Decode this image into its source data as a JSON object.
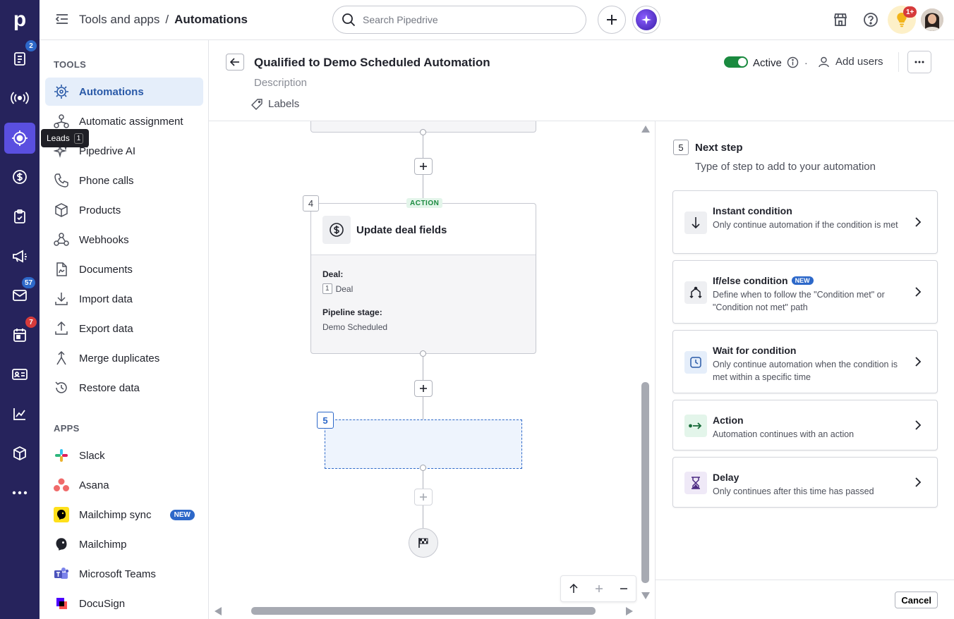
{
  "app": {
    "logo": "p"
  },
  "rail": {
    "items": [
      {
        "icon": "contacts-icon",
        "badge": "2"
      },
      {
        "icon": "broadcast-icon",
        "badge": ""
      },
      {
        "icon": "target-icon",
        "badge": "",
        "active": true
      },
      {
        "icon": "dollar-icon",
        "badge": ""
      },
      {
        "icon": "clipboard-icon",
        "badge": ""
      },
      {
        "icon": "megaphone-icon",
        "badge": ""
      },
      {
        "icon": "mail-icon",
        "badge": "57"
      },
      {
        "icon": "calendar-icon",
        "badge": "7"
      },
      {
        "icon": "id-card-icon",
        "badge": ""
      },
      {
        "icon": "chart-icon",
        "badge": ""
      },
      {
        "icon": "box-icon",
        "badge": ""
      },
      {
        "icon": "more-icon",
        "badge": ""
      }
    ],
    "tooltip": {
      "label": "Leads",
      "key": "1"
    }
  },
  "topbar": {
    "breadcrumb_parent": "Tools and apps",
    "breadcrumb_sep": "/",
    "breadcrumb_current": "Automations",
    "search_placeholder": "Search Pipedrive",
    "notif_badge": "1+"
  },
  "sidebar": {
    "tools_title": "TOOLS",
    "tools": [
      {
        "label": "Automations",
        "icon": "automation-icon",
        "active": true
      },
      {
        "label": "Automatic assignment",
        "icon": "assignment-icon"
      },
      {
        "label": "Pipedrive AI",
        "icon": "sparkle-icon"
      },
      {
        "label": "Phone calls",
        "icon": "phone-icon"
      },
      {
        "label": "Products",
        "icon": "box-icon"
      },
      {
        "label": "Webhooks",
        "icon": "webhook-icon"
      },
      {
        "label": "Documents",
        "icon": "document-icon"
      },
      {
        "label": "Import data",
        "icon": "download-icon"
      },
      {
        "label": "Export data",
        "icon": "upload-icon"
      },
      {
        "label": "Merge duplicates",
        "icon": "merge-icon"
      },
      {
        "label": "Restore data",
        "icon": "restore-icon"
      }
    ],
    "apps_title": "APPS",
    "apps": [
      {
        "label": "Slack",
        "icon": "slack-icon"
      },
      {
        "label": "Asana",
        "icon": "asana-icon"
      },
      {
        "label": "Mailchimp sync",
        "icon": "mailchimp-sync-icon",
        "badge": "NEW"
      },
      {
        "label": "Mailchimp",
        "icon": "mailchimp-icon"
      },
      {
        "label": "Microsoft Teams",
        "icon": "teams-icon"
      },
      {
        "label": "DocuSign",
        "icon": "docusign-icon"
      }
    ]
  },
  "editor": {
    "title": "Qualified to Demo Scheduled Automation",
    "description_placeholder": "Description",
    "labels_label": "Labels",
    "status_label": "Active",
    "add_users_label": "Add users"
  },
  "canvas": {
    "step4": {
      "number": "4",
      "tag": "ACTION",
      "title": "Update deal fields",
      "field1_label": "Deal:",
      "field1_ref": "1",
      "field1_value": "Deal",
      "field2_label": "Pipeline stage:",
      "field2_value": "Demo Scheduled"
    },
    "step5_number": "5"
  },
  "panel": {
    "step_number": "5",
    "title": "Next step",
    "subtitle": "Type of step to add to your automation",
    "options": [
      {
        "title": "Instant condition",
        "desc": "Only continue automation if the condition is met",
        "icon": "arrow-down-icon",
        "badge": ""
      },
      {
        "title": "If/else condition",
        "desc": "Define when to follow the \"Condition met\" or \"Condition not met\" path",
        "icon": "branch-icon",
        "badge": "NEW"
      },
      {
        "title": "Wait for condition",
        "desc": "Only continue automation when the condition is met within a specific time",
        "icon": "clock-icon",
        "badge": ""
      },
      {
        "title": "Action",
        "desc": "Automation continues with an action",
        "icon": "action-arrow-icon",
        "badge": ""
      },
      {
        "title": "Delay",
        "desc": "Only continues after this time has passed",
        "icon": "hourglass-icon",
        "badge": ""
      }
    ],
    "cancel_label": "Cancel"
  },
  "colors": {
    "rail_bg": "#26235c",
    "rail_active": "#5a4fe0",
    "accent_blue": "#2d68c9",
    "active_green": "#1a8a3f",
    "badge_blue": "#2d68c9",
    "badge_red": "#d63b3b"
  }
}
